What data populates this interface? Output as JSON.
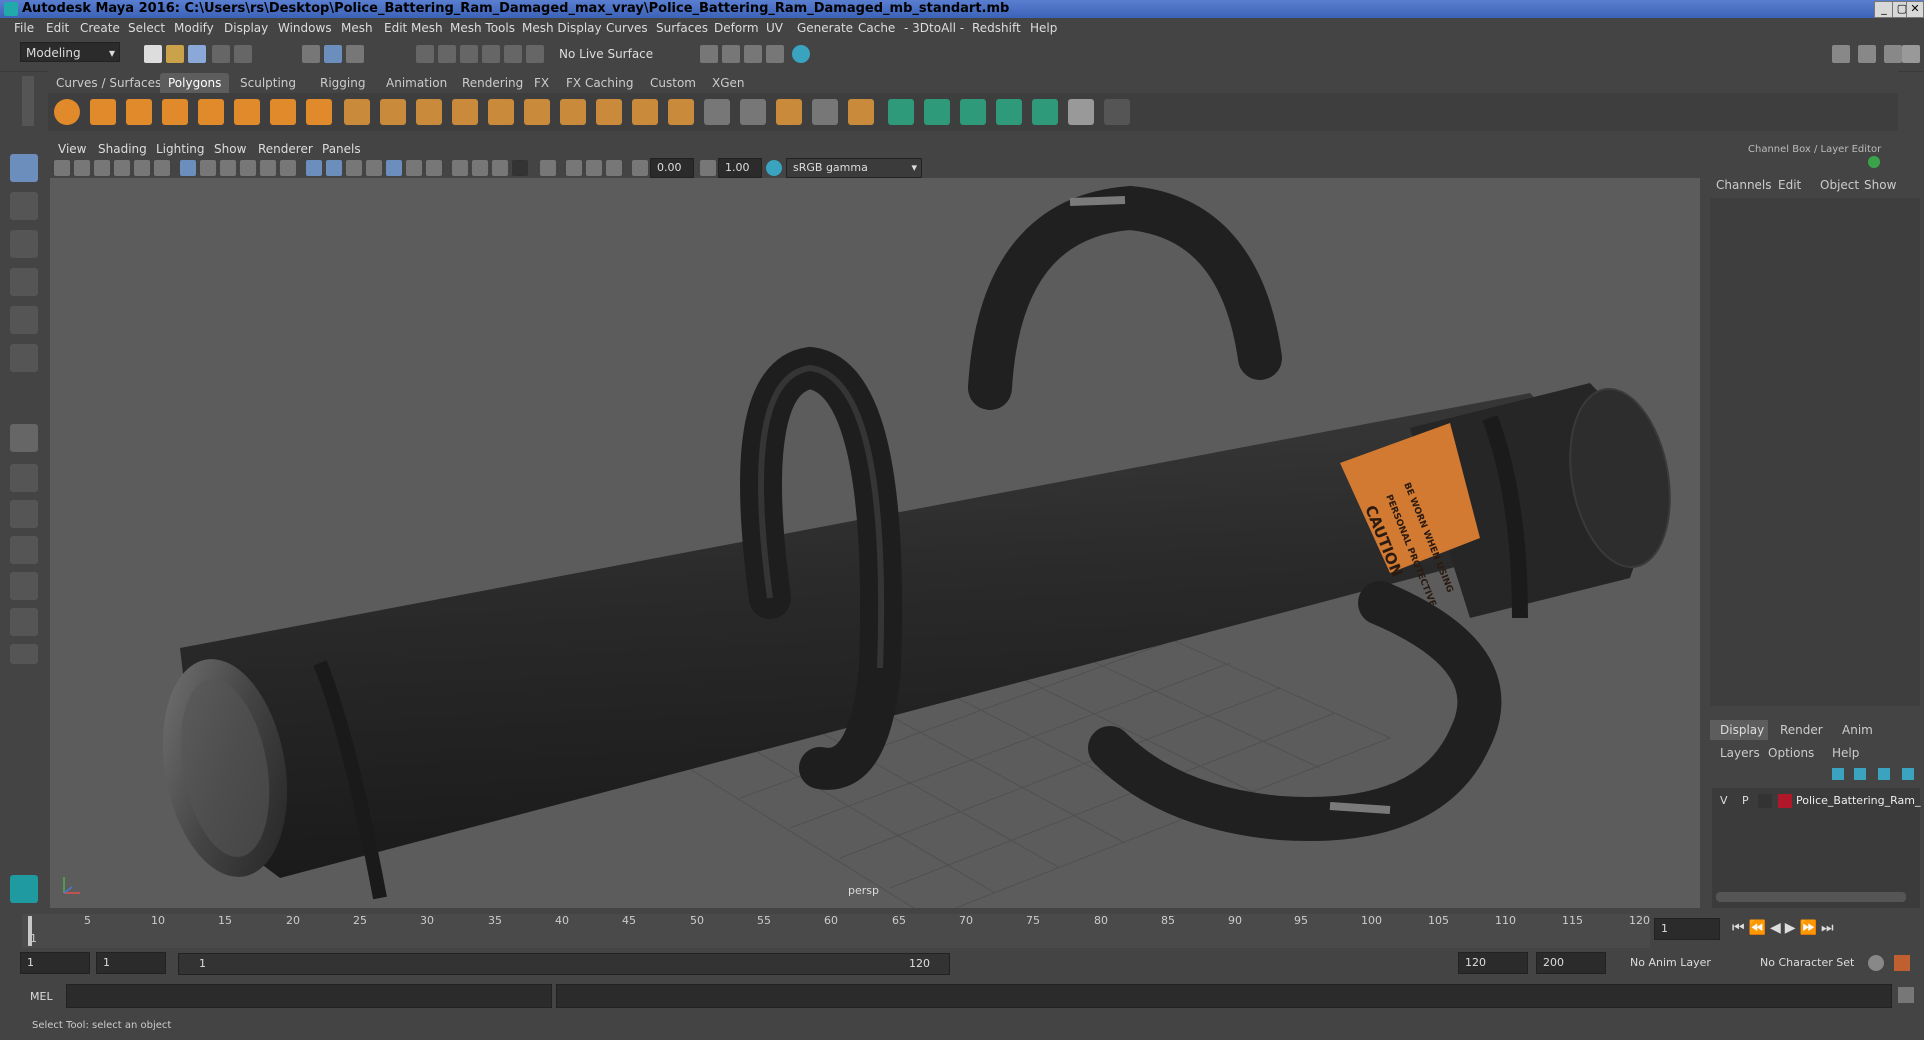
{
  "window": {
    "title": "Autodesk Maya 2016: C:\\Users\\rs\\Desktop\\Police_Battering_Ram_Damaged_max_vray\\Police_Battering_Ram_Damaged_mb_standart.mb",
    "min": "_",
    "max": "▢",
    "close": "✕"
  },
  "menus": [
    "File",
    "Edit",
    "Create",
    "Select",
    "Modify",
    "Display",
    "Windows",
    "Mesh",
    "Edit Mesh",
    "Mesh Tools",
    "Mesh Display",
    "Curves",
    "Surfaces",
    "Deform",
    "UV",
    "Generate",
    "Cache",
    "- 3DtoAll -",
    "Redshift",
    "Help"
  ],
  "toolbar": {
    "mode": "Modeling",
    "live_surface": "No Live Surface"
  },
  "shelf_tabs": [
    "Curves / Surfaces",
    "Polygons",
    "Sculpting",
    "Rigging",
    "Animation",
    "Rendering",
    "FX",
    "FX Caching",
    "Custom",
    "XGen"
  ],
  "active_shelf_tab": "Polygons",
  "viewport_menu": [
    "View",
    "Shading",
    "Lighting",
    "Show",
    "Renderer",
    "Panels"
  ],
  "viewport_fields": {
    "exposure": "0.00",
    "gamma": "1.00",
    "color_space": "sRGB gamma"
  },
  "viewport_label": "persp",
  "decal": {
    "line1": "CAUTION",
    "line2": "PERSONAL PROTECTIVE",
    "line3": "BE WORN WHEN USING"
  },
  "channel_box": {
    "title": "Channel Box / Layer Editor",
    "menu": [
      "Channels",
      "Edit",
      "Object",
      "Show"
    ]
  },
  "layer_editor": {
    "tabs": [
      "Display",
      "Render",
      "Anim"
    ],
    "active_tab": "Display",
    "menu": [
      "Layers",
      "Options",
      "Help"
    ],
    "layer": {
      "v": "V",
      "p": "P",
      "name": "Police_Battering_Ram_",
      "color": "#b0182a"
    }
  },
  "timeline": {
    "ticks": [
      "5",
      "10",
      "15",
      "20",
      "25",
      "30",
      "35",
      "40",
      "45",
      "50",
      "55",
      "60",
      "65",
      "70",
      "75",
      "80",
      "85",
      "90",
      "95",
      "100",
      "105",
      "110",
      "115",
      "120"
    ],
    "start_label": "1",
    "current_frame": "1"
  },
  "range": {
    "start": "1",
    "playback_start": "1",
    "slider_start": "1",
    "slider_end": "120",
    "end": "120",
    "anim_end": "200",
    "anim_layer": "No Anim Layer",
    "character_set": "No Character Set"
  },
  "command_line": {
    "label": "MEL"
  },
  "status": {
    "text": "Select Tool: select an object"
  }
}
